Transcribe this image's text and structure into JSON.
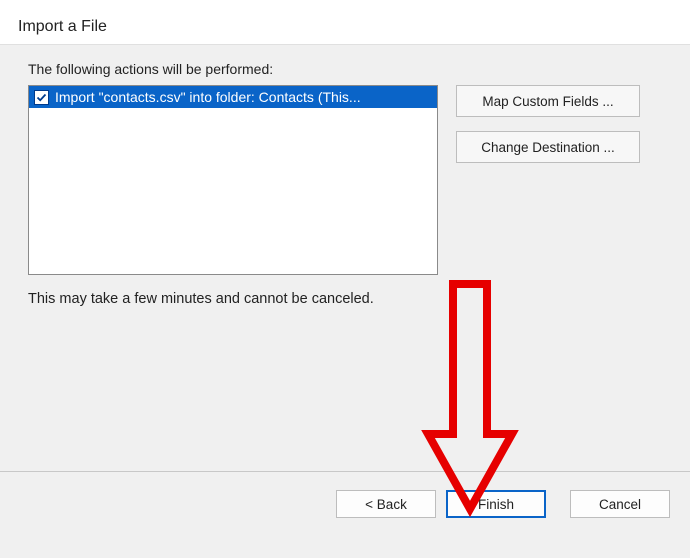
{
  "header": {
    "title": "Import a File"
  },
  "intro": "The following actions will be performed:",
  "actions": [
    {
      "label": "Import \"contacts.csv\" into folder: Contacts (This...",
      "checked": true
    }
  ],
  "sideButtons": {
    "mapFields": "Map Custom Fields ...",
    "changeDest": "Change Destination ..."
  },
  "note": "This may take a few minutes and cannot be canceled.",
  "footer": {
    "back": "< Back",
    "finish": "Finish",
    "cancel": "Cancel"
  },
  "annotation": {
    "arrowColor": "#e60000"
  }
}
